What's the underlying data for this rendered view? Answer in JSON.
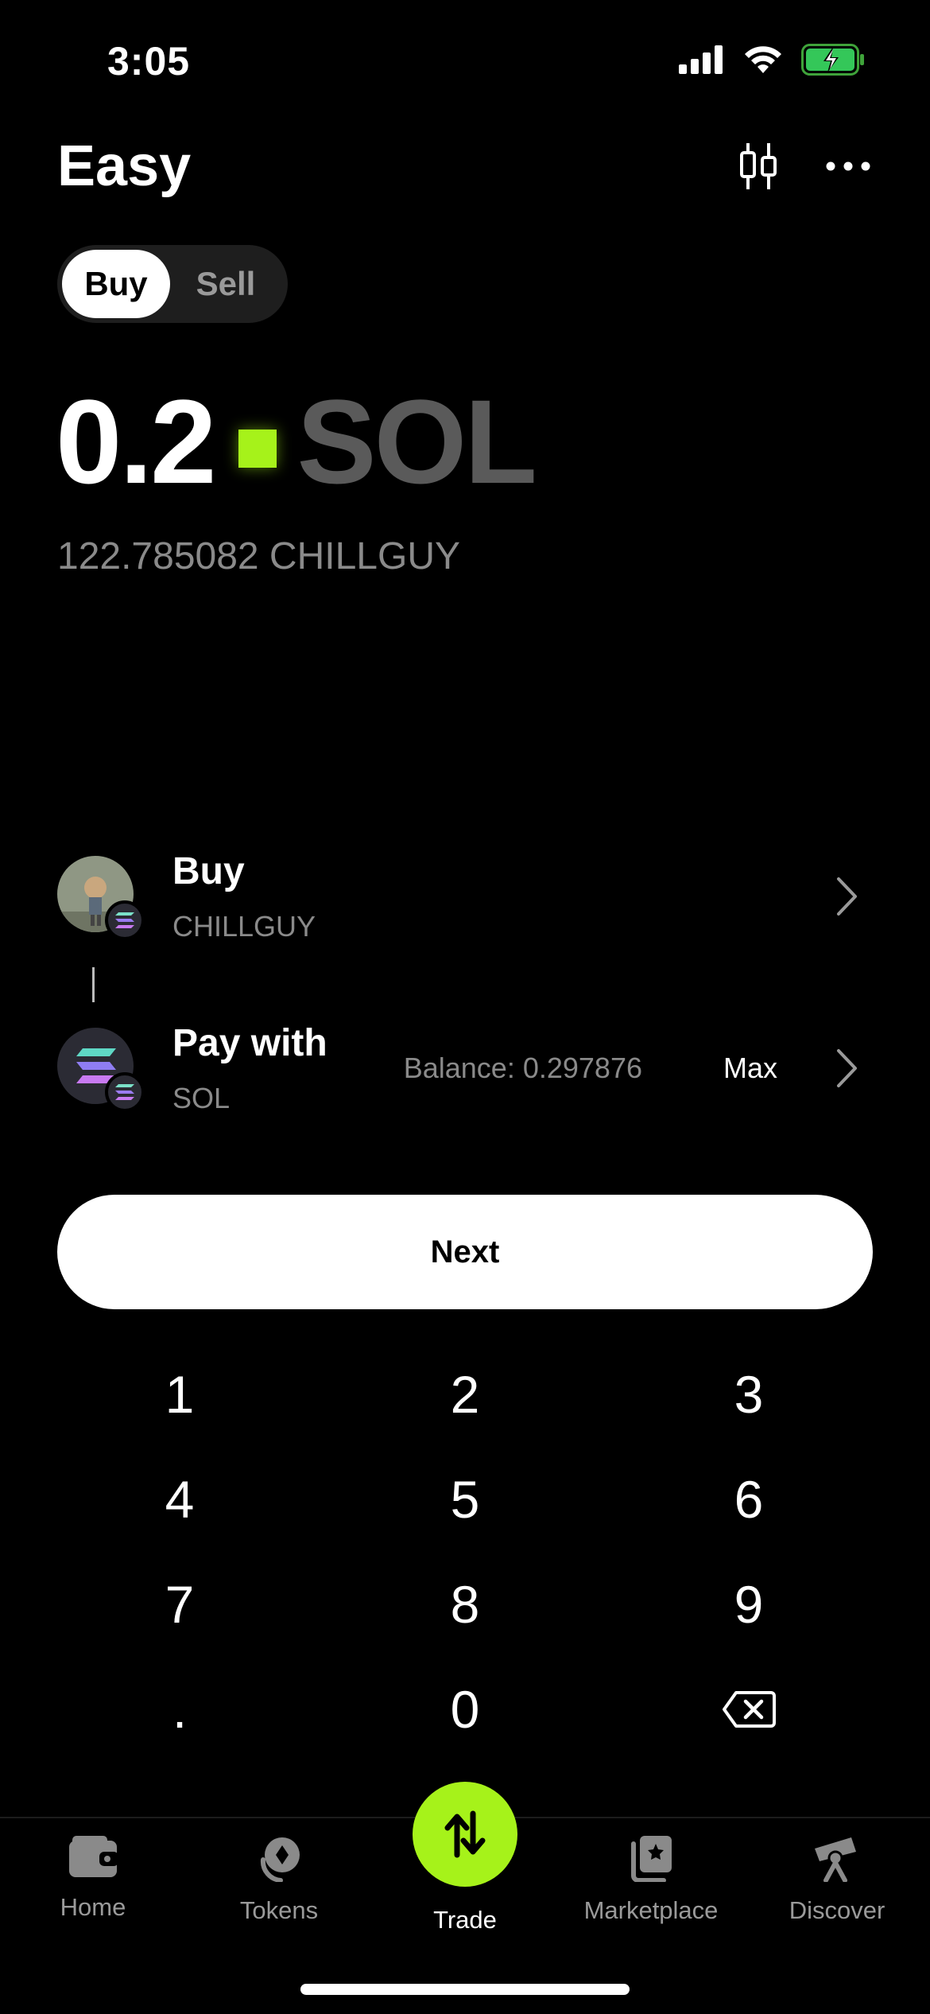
{
  "status_bar": {
    "time": "3:05"
  },
  "header": {
    "title": "Easy",
    "chart_icon": "candlestick-icon",
    "menu_icon": "more-icon"
  },
  "mode": {
    "buy_label": "Buy",
    "sell_label": "Sell",
    "selected": "Buy"
  },
  "amount": {
    "value": "0.2",
    "unit": "SOL",
    "converted": "122.785082 CHILLGUY"
  },
  "buy_row": {
    "label": "Buy",
    "token": "CHILLGUY"
  },
  "pay_row": {
    "label": "Pay with",
    "token": "SOL",
    "balance": "Balance: 0.297876",
    "max_label": "Max"
  },
  "next_button": {
    "label": "Next"
  },
  "keypad": {
    "keys": [
      "1",
      "2",
      "3",
      "4",
      "5",
      "6",
      "7",
      "8",
      "9",
      ".",
      "0"
    ],
    "backspace_icon": "backspace-icon"
  },
  "tabs": [
    {
      "label": "Home",
      "icon": "wallet-icon"
    },
    {
      "label": "Tokens",
      "icon": "tokens-icon"
    },
    {
      "label": "Trade",
      "icon": "swap-icon",
      "active": true
    },
    {
      "label": "Marketplace",
      "icon": "marketplace-icon"
    },
    {
      "label": "Discover",
      "icon": "telescope-icon"
    }
  ],
  "colors": {
    "accent": "#a6f21a",
    "background": "#000000",
    "muted": "#8a8a8a"
  }
}
